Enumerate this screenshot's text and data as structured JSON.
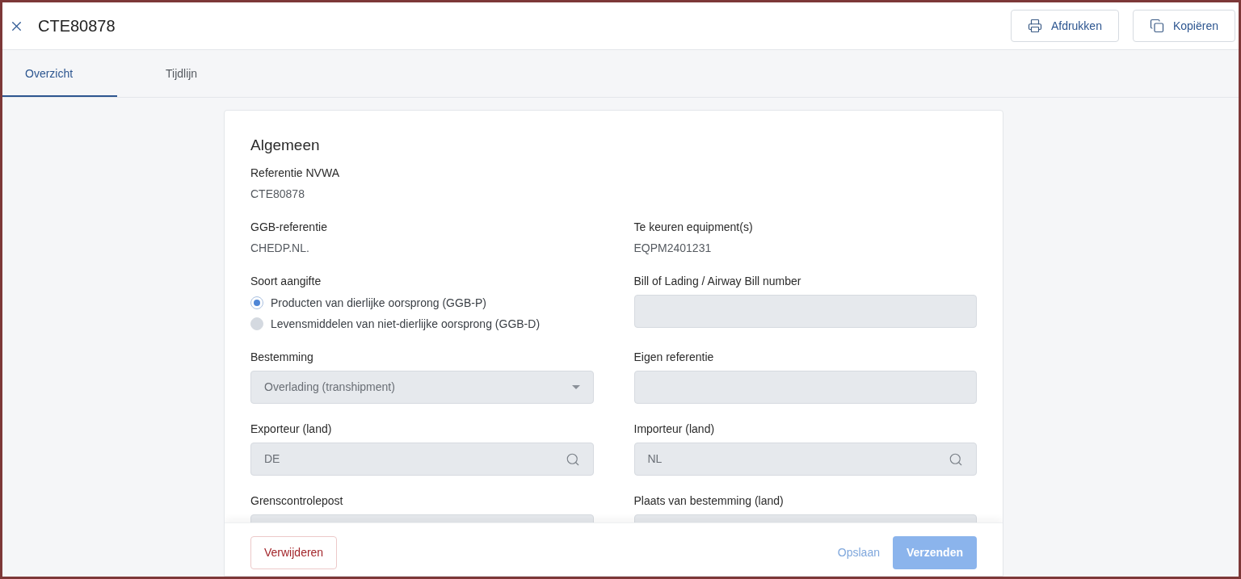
{
  "header": {
    "title": "CTE80878",
    "actions": [
      {
        "kind": "print",
        "label": "Afdrukken"
      },
      {
        "kind": "copy",
        "label": "Kopiëren"
      }
    ]
  },
  "tabs": [
    {
      "label": "Overzicht",
      "selected": true
    },
    {
      "label": "Tijdlijn",
      "selected": false
    }
  ],
  "section": {
    "title": "Algemeen",
    "rows": [
      [
        {
          "kind": "text",
          "label": "Referentie NVWA",
          "value": "CTE80878"
        }
      ],
      [
        {
          "kind": "text",
          "label": "GGB-referentie",
          "value": "CHEDP.NL."
        },
        {
          "kind": "text",
          "label": "Te keuren equipment(s)",
          "value": "EQPM2401231"
        }
      ],
      [
        {
          "kind": "radio",
          "label": "Soort aangifte",
          "options": [
            {
              "label": "Producten van dierlijke oorsprong (GGB-P)",
              "selected": true
            },
            {
              "label": "Levensmiddelen van niet-dierlijke oorsprong (GGB-D)",
              "selected": false
            }
          ]
        },
        {
          "kind": "input",
          "label": "Bill of Lading / Airway Bill number"
        }
      ],
      [
        {
          "kind": "select",
          "label": "Bestemming",
          "value": "Overlading (transhipment)"
        },
        {
          "kind": "input",
          "label": "Eigen referentie"
        }
      ],
      [
        {
          "kind": "search",
          "label": "Exporteur (land)",
          "value": "DE"
        },
        {
          "kind": "search",
          "label": "Importeur (land)",
          "value": "NL"
        }
      ],
      [
        {
          "kind": "input",
          "label": "Grenscontrolepost"
        },
        {
          "kind": "input",
          "label": "Plaats van bestemming (land)"
        }
      ]
    ]
  },
  "footer": [
    {
      "kind": "danger",
      "label": "Verwijderen",
      "disabled": false
    },
    {
      "kind": "link",
      "label": "Opslaan",
      "disabled": true
    },
    {
      "kind": "primary",
      "label": "Verzenden",
      "disabled": true
    }
  ]
}
